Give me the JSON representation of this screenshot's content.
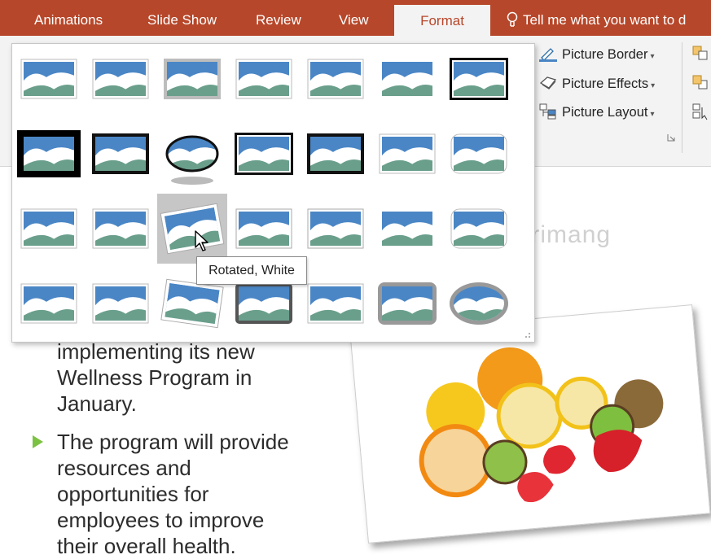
{
  "ribbon": {
    "tabs": [
      {
        "label": "Animations"
      },
      {
        "label": "Slide Show"
      },
      {
        "label": "Review"
      },
      {
        "label": "View"
      },
      {
        "label": "Format",
        "active": true
      }
    ],
    "tell_me": "Tell me what you want to d",
    "commands": {
      "picture_border": "Picture Border",
      "picture_effects": "Picture Effects",
      "picture_layout": "Picture Layout"
    }
  },
  "gallery": {
    "styles": [
      "thumb",
      "thumb",
      "thumb",
      "thumb",
      "thumb",
      "thumb",
      "thumb",
      "thumb",
      "thumb",
      "thumb",
      "thumb",
      "thumb",
      "thumb",
      "thumb",
      "thumb",
      "thumb",
      "Rotated, White",
      "thumb",
      "thumb",
      "thumb",
      "thumb",
      "thumb",
      "thumb",
      "thumb",
      "thumb",
      "thumb",
      "thumb",
      "thumb"
    ],
    "hover_index": 16,
    "tooltip": "Rotated, White"
  },
  "slide": {
    "bullets": [
      {
        "lines": [
          "implementing its new",
          "Wellness Program in",
          "January."
        ]
      },
      {
        "lines": [
          "The program will provide",
          "resources and",
          "opportunities for",
          "employees to improve",
          "their overall health."
        ]
      }
    ]
  },
  "watermark": "uantrimang",
  "colors": {
    "tab_bar": "#b7472a",
    "ribbon_bg": "#f3f3f3",
    "bullet": "#7cc242",
    "sky": "#4a86c5",
    "hill": "#6a9f8c"
  }
}
